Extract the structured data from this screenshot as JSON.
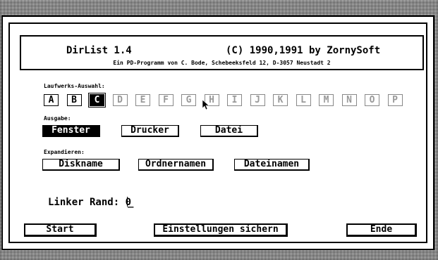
{
  "title": {
    "app_name": "DirList 1.4",
    "copyright": "(C) 1990,1991 by ZornySoft",
    "subtitle": "Ein PD-Programm von C. Bode, Schebeeksfeld 12, D-3057 Neustadt 2"
  },
  "drives": {
    "label": "Laufwerks-Auswahl:",
    "items": [
      {
        "letter": "A",
        "state": "enabled"
      },
      {
        "letter": "B",
        "state": "enabled"
      },
      {
        "letter": "C",
        "state": "selected"
      },
      {
        "letter": "D",
        "state": "disabled"
      },
      {
        "letter": "E",
        "state": "disabled"
      },
      {
        "letter": "F",
        "state": "disabled"
      },
      {
        "letter": "G",
        "state": "disabled"
      },
      {
        "letter": "H",
        "state": "disabled"
      },
      {
        "letter": "I",
        "state": "disabled"
      },
      {
        "letter": "J",
        "state": "disabled"
      },
      {
        "letter": "K",
        "state": "disabled"
      },
      {
        "letter": "L",
        "state": "disabled"
      },
      {
        "letter": "M",
        "state": "disabled"
      },
      {
        "letter": "N",
        "state": "disabled"
      },
      {
        "letter": "O",
        "state": "disabled"
      },
      {
        "letter": "P",
        "state": "disabled"
      }
    ]
  },
  "output": {
    "label": "Ausgabe:",
    "options": [
      "Fenster",
      "Drucker",
      "Datei"
    ],
    "selected": "Fenster"
  },
  "expand": {
    "label": "Expandieren:",
    "options": [
      "Diskname",
      "Ordnernamen",
      "Dateinamen"
    ]
  },
  "margin": {
    "label": "Linker Rand:",
    "value": "0",
    "blank": "_"
  },
  "buttons": {
    "start": "Start",
    "save": "Einstellungen sichern",
    "end": "Ende"
  }
}
